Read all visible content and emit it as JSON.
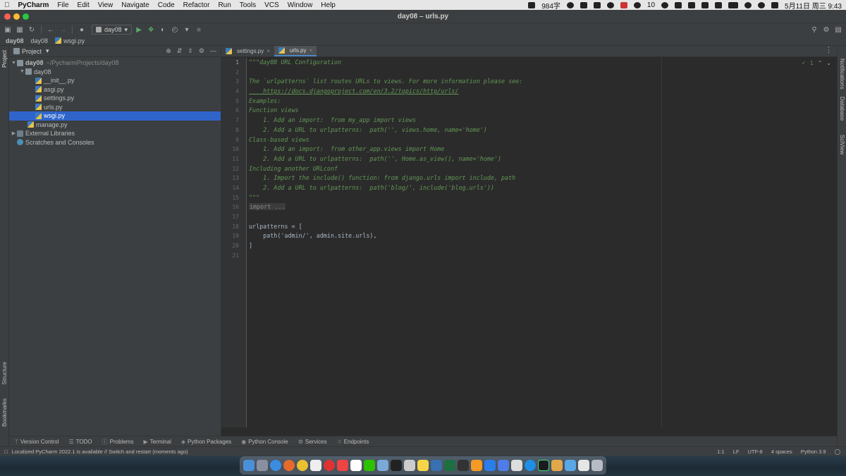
{
  "mac_menubar": {
    "app_name": "PyCharm",
    "menus": [
      "File",
      "Edit",
      "View",
      "Navigate",
      "Code",
      "Refactor",
      "Run",
      "Tools",
      "VCS",
      "Window",
      "Help"
    ],
    "status": {
      "word_count": "984字",
      "wechat_badge": "10",
      "clock": "5月11日 周三  9:43"
    }
  },
  "window": {
    "title": "day08 – urls.py"
  },
  "toolbar": {
    "run_config": "day08"
  },
  "navbar": {
    "crumbs": [
      "day08",
      "day08",
      "wsgi.py"
    ]
  },
  "left_stripe": {
    "project": "Project",
    "structure": "Structure",
    "bookmarks": "Bookmarks"
  },
  "right_stripe": {
    "notifications": "Notifications",
    "database": "Database",
    "sciview": "SciView"
  },
  "project_panel": {
    "title": "Project",
    "root": {
      "name": "day08",
      "path": "~/PycharmProjects/day08"
    },
    "pkg": "day08",
    "files": [
      "__init__.py",
      "asgi.py",
      "settings.py",
      "urls.py",
      "wsgi.py"
    ],
    "manage": "manage.py",
    "external": "External Libraries",
    "scratches": "Scratches and Consoles"
  },
  "editor": {
    "tabs": [
      "settings.py",
      "urls.py"
    ],
    "inspection_count": "1",
    "lines": [
      "\"\"\"day08 URL Configuration",
      "",
      "The `urlpatterns` list routes URLs to views. For more information please see:",
      "    https://docs.djangoproject.com/en/3.2/topics/http/urls/",
      "Examples:",
      "Function views",
      "    1. Add an import:  from my_app import views",
      "    2. Add a URL to urlpatterns:  path('', views.home, name='home')",
      "Class-based views",
      "    1. Add an import:  from other_app.views import Home",
      "    2. Add a URL to urlpatterns:  path('', Home.as_view(), name='home')",
      "Including another URLconf",
      "    1. Import the include() function: from django.urls import include, path",
      "    2. Add a URL to urlpatterns:  path('blog/', include('blog.urls'))",
      "\"\"\"",
      "import ...",
      "",
      "urlpatterns = [",
      "    path('admin/', admin.site.urls),",
      "]",
      ""
    ]
  },
  "bottom_tools": [
    "Version Control",
    "TODO",
    "Problems",
    "Terminal",
    "Python Packages",
    "Python Console",
    "Services",
    "Endpoints"
  ],
  "statusbar": {
    "message": "Localized PyCharm 2022.1 is available // Switch and restart (moments ago)",
    "position": "1:1",
    "line_sep": "LF",
    "encoding": "UTF-8",
    "indent": "4 spaces",
    "interpreter": "Python 3.9"
  },
  "colors": {
    "selection": "#2f65ca",
    "docstring": "#629755",
    "background": "#2b2b2b",
    "panel": "#3c3f41"
  }
}
